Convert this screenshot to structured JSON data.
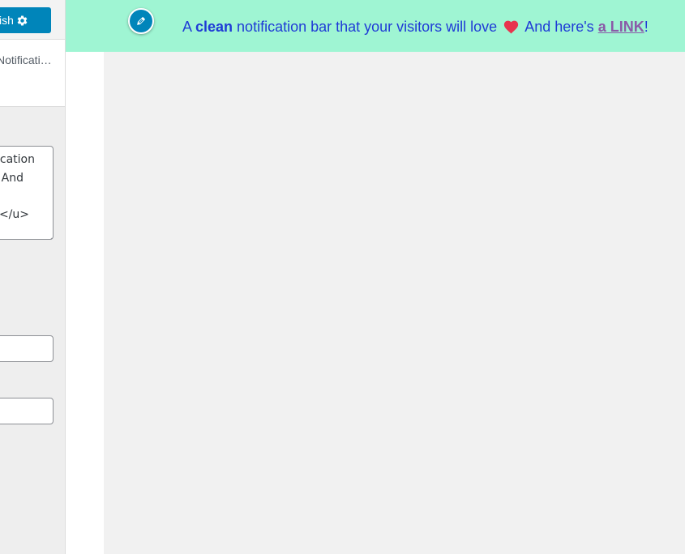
{
  "sidebar": {
    "publish_label": "ish",
    "breadcrumb": "Notificati…",
    "textarea_lines": [
      "cation",
      "And",
      "",
      "</u>"
    ],
    "field1_value": "",
    "field2_value": ""
  },
  "notification_bar": {
    "prefix": "A ",
    "bold_word": "clean",
    "middle": " notification bar that your visitors will love ",
    "after_heart": " And here's ",
    "link_text": "a LINK",
    "suffix": "!",
    "bg_color": "#9ff5d3",
    "text_color": "#1f3bd6",
    "link_color": "#8a5aa8",
    "heart_color": "#e8344e"
  },
  "icons": {
    "gear": "gear-icon",
    "pencil": "pencil-icon",
    "heart": "heart-icon"
  },
  "colors": {
    "publish_button": "#0085ba",
    "preview_background": "#f1f1f1"
  }
}
